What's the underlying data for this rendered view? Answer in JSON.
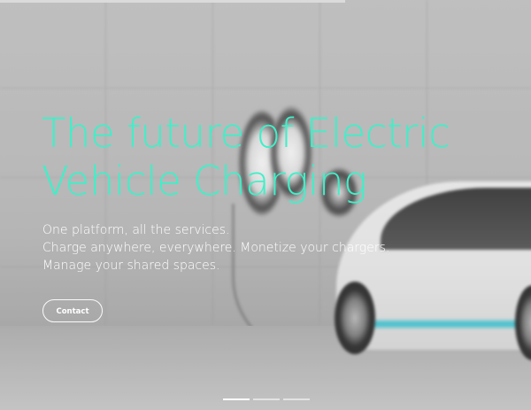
{
  "hero": {
    "headline_line1": "The future of Electric",
    "headline_line2": "Vehicle Charging",
    "subtext_line1": "One platform, all the services.",
    "subtext_line2": "Charge anywhere, everywhere. Monetize your chargers.",
    "subtext_line3": "Manage your shared spaces.",
    "contact_label": "Contact"
  },
  "slider": {
    "slide_count": 3,
    "active_index": 0
  },
  "colors": {
    "headline": "#3ef0c8",
    "text": "#ffffff",
    "car_trim": "#3ac7d6"
  },
  "background": {
    "image_subject": "white electric car charging at wall-mounted chargers in concrete garage"
  }
}
